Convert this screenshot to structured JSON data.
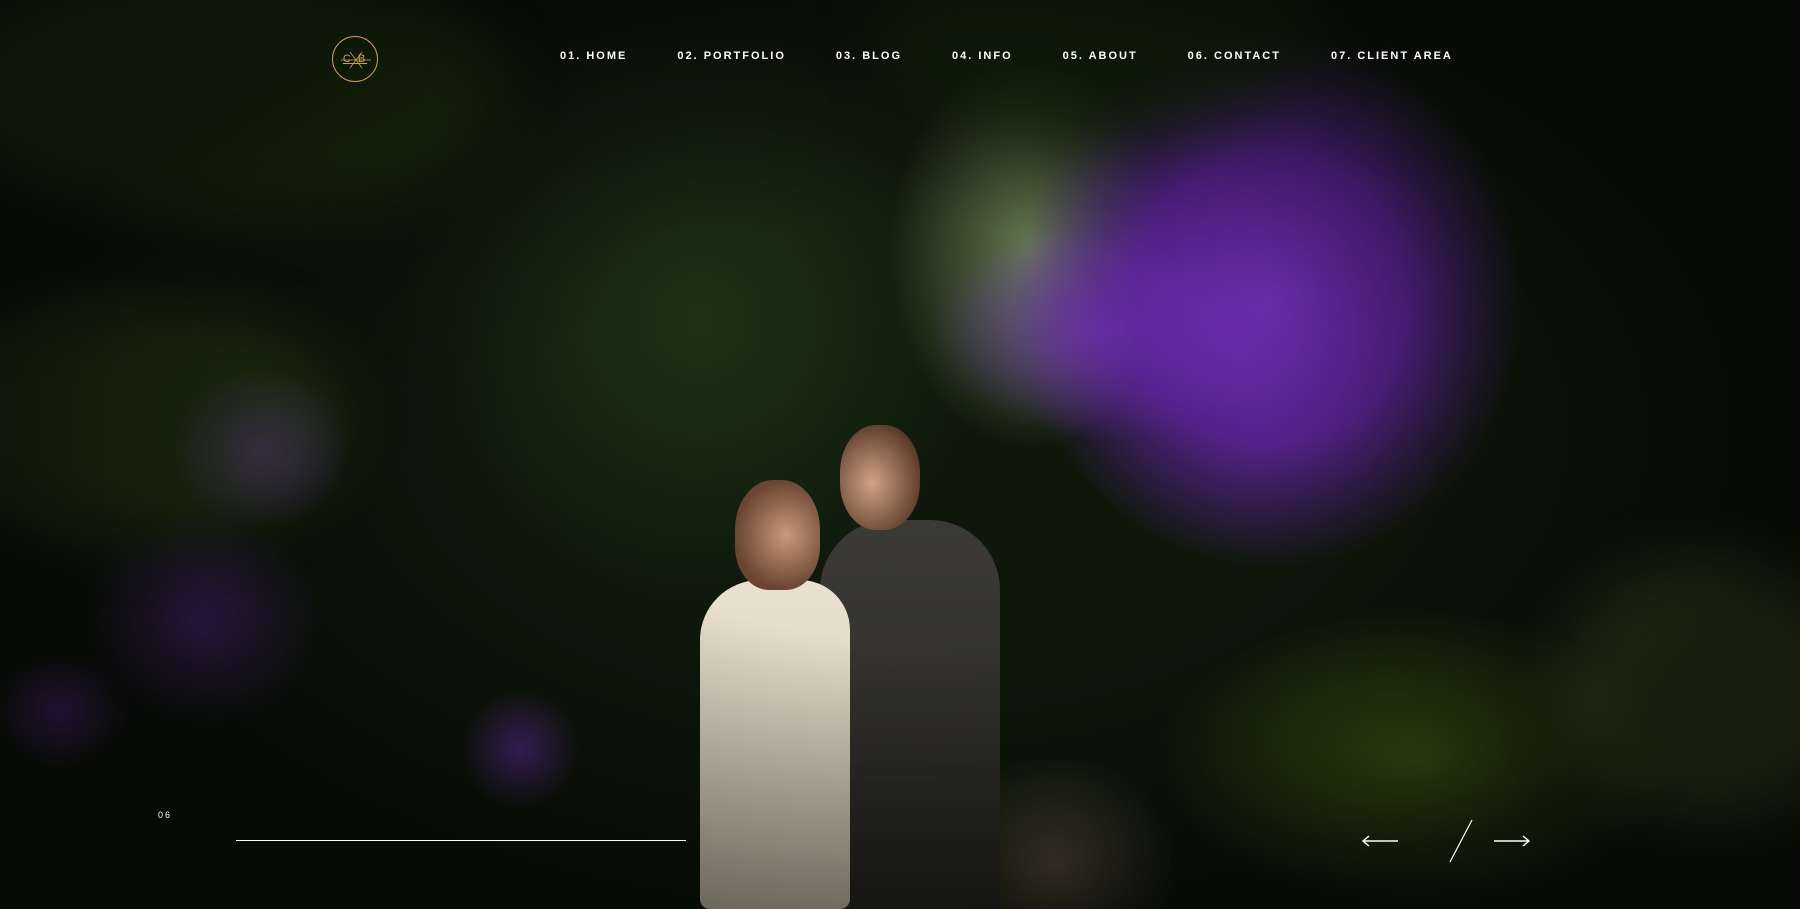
{
  "site": {
    "logo_text": "C B",
    "accent_color": "#c9a24a"
  },
  "nav": {
    "items": [
      {
        "label": "01. HOME"
      },
      {
        "label": "02. PORTFOLIO"
      },
      {
        "label": "03. BLOG"
      },
      {
        "label": "04. INFO"
      },
      {
        "label": "05. ABOUT"
      },
      {
        "label": "06. CONTACT"
      },
      {
        "label": "07. CLIENT AREA"
      }
    ]
  },
  "slider": {
    "counter": "06",
    "progress_fraction": 1.0,
    "prev_icon": "arrow-left-icon",
    "next_icon": "arrow-right-icon"
  }
}
